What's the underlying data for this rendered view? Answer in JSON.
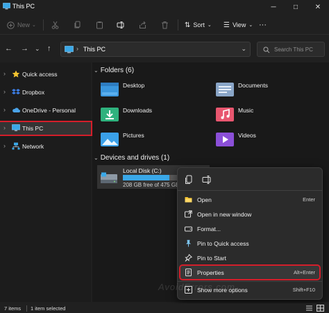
{
  "window": {
    "title": "This PC",
    "minimize": "─",
    "maximize": "□",
    "close": "✕"
  },
  "toolbar": {
    "new_label": "New",
    "sort_label": "Sort",
    "view_label": "View",
    "more_label": "···"
  },
  "address": {
    "path": "This PC",
    "search_placeholder": "Search This PC"
  },
  "sidebar": {
    "items": [
      {
        "label": "Quick access",
        "icon": "star-icon"
      },
      {
        "label": "Dropbox",
        "icon": "dropbox-icon"
      },
      {
        "label": "OneDrive - Personal",
        "icon": "cloud-icon"
      },
      {
        "label": "This PC",
        "icon": "monitor-icon"
      },
      {
        "label": "Network",
        "icon": "network-icon"
      }
    ]
  },
  "folders": {
    "header": "Folders (6)",
    "items": [
      {
        "label": "Desktop",
        "icon": "desktop-folder-icon",
        "color": "#3a96dd"
      },
      {
        "label": "Documents",
        "icon": "documents-folder-icon",
        "color": "#8aa6c8"
      },
      {
        "label": "Downloads",
        "icon": "downloads-folder-icon",
        "color": "#2fb27e"
      },
      {
        "label": "Music",
        "icon": "music-folder-icon",
        "color": "#e8566f"
      },
      {
        "label": "Pictures",
        "icon": "pictures-folder-icon",
        "color": "#3aa0e8"
      },
      {
        "label": "Videos",
        "icon": "videos-folder-icon",
        "color": "#8b4fd8"
      }
    ]
  },
  "drives": {
    "header": "Devices and drives (1)",
    "items": [
      {
        "name": "Local Disk (C:)",
        "free": "208 GB free of 475 GB",
        "used_fraction": 0.56
      }
    ]
  },
  "context_menu": {
    "quick_actions": [
      "copy-icon",
      "rename-icon"
    ],
    "items": [
      {
        "label": "Open",
        "shortcut": "Enter",
        "icon": "open-folder-icon"
      },
      {
        "label": "Open in new window",
        "shortcut": "",
        "icon": "new-window-icon"
      },
      {
        "label": "Format...",
        "shortcut": "",
        "icon": "format-icon"
      },
      {
        "label": "Pin to Quick access",
        "shortcut": "",
        "icon": "pin-icon"
      },
      {
        "label": "Pin to Start",
        "shortcut": "",
        "icon": "pin-start-icon"
      },
      {
        "label": "Properties",
        "shortcut": "Alt+Enter",
        "icon": "properties-icon"
      },
      {
        "label": "Show more options",
        "shortcut": "Shift+F10",
        "icon": "more-options-icon"
      }
    ]
  },
  "watermark": "AvoidErrors.com",
  "status": {
    "items_count": "7 items",
    "selected": "1 item selected"
  },
  "colors": {
    "accent": "#3aa8e8",
    "highlight_outline": "#d41e2a"
  }
}
